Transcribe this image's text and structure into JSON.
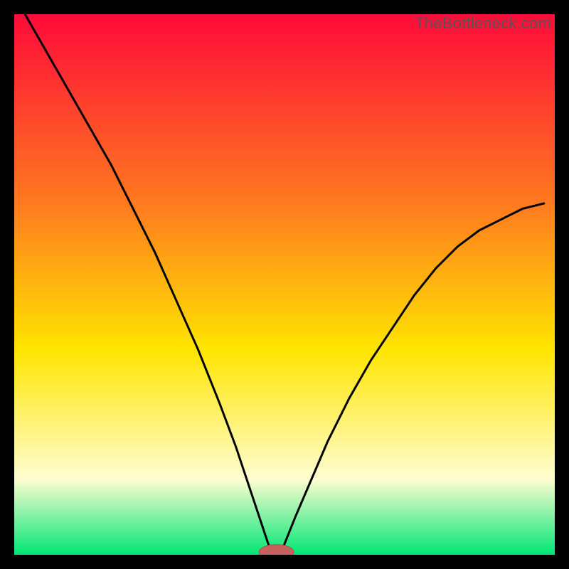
{
  "watermark": "TheBottleneck.com",
  "colors": {
    "frame": "#000000",
    "gradient_top": "#ff0b3a",
    "gradient_mid1": "#ff7a1f",
    "gradient_mid2": "#ffe500",
    "gradient_low": "#fffdd0",
    "gradient_bottom": "#00e676",
    "curve": "#000000",
    "marker_fill": "#c6615f",
    "marker_stroke": "#b24f4c"
  },
  "chart_data": {
    "type": "line",
    "title": "",
    "xlabel": "",
    "ylabel": "",
    "xlim": [
      0,
      100
    ],
    "ylim": [
      0,
      100
    ],
    "grid": false,
    "legend": false,
    "notes": "Background is a vertical red→orange→yellow→pale→green gradient. A black V-shaped curve descends from top-left toward a minimum near x≈48 then rises toward the right edge reaching ≈65% height. A small rounded red marker sits at the curve's minimum near the bottom.",
    "series": [
      {
        "name": "curve",
        "x": [
          2,
          6,
          10,
          14,
          18,
          22,
          26,
          30,
          34,
          38,
          41,
          44,
          46,
          47,
          48,
          49,
          50,
          52,
          55,
          58,
          62,
          66,
          70,
          74,
          78,
          82,
          86,
          90,
          94,
          98
        ],
        "y": [
          100,
          93,
          86,
          79,
          72,
          64,
          56,
          47,
          38,
          28,
          20,
          11,
          5,
          2,
          0,
          0,
          2,
          7,
          14,
          21,
          29,
          36,
          42,
          48,
          53,
          57,
          60,
          62,
          64,
          65
        ]
      }
    ],
    "marker": {
      "x": 48.5,
      "y": 0.5,
      "rx": 3.2,
      "ry": 1.4
    }
  }
}
